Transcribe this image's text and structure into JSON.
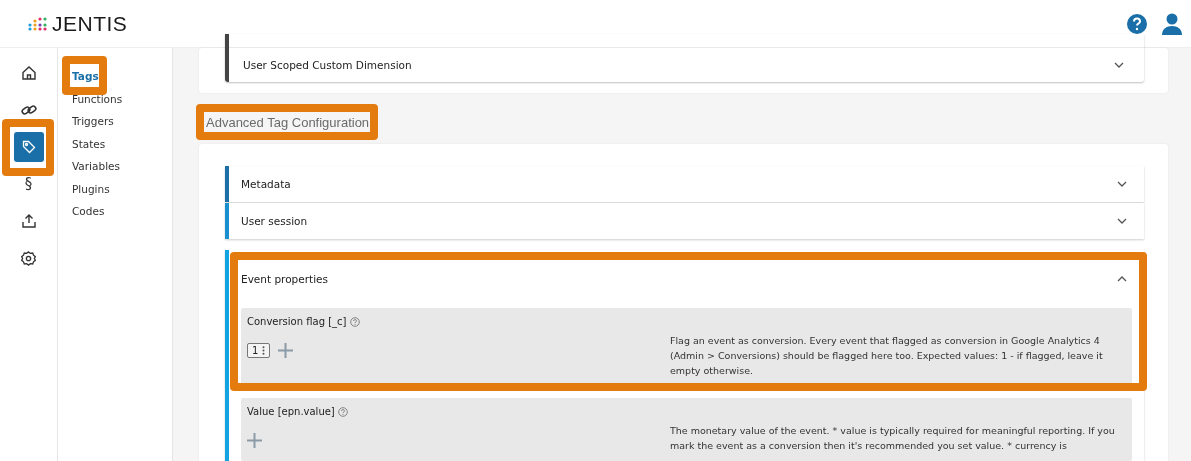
{
  "header": {
    "logo": "JENTIS"
  },
  "nav_rail": [
    {
      "kind": "home",
      "selected": false,
      "highlighted": false
    },
    {
      "kind": "link",
      "selected": false,
      "highlighted": false
    },
    {
      "kind": "tag",
      "selected": true,
      "highlighted": true
    },
    {
      "kind": "text",
      "label": "§",
      "selected": false,
      "highlighted": false
    },
    {
      "kind": "upload",
      "selected": false,
      "highlighted": false
    },
    {
      "kind": "settings",
      "selected": false,
      "highlighted": false
    }
  ],
  "sidebar": {
    "items": [
      {
        "label": "Tags",
        "selected": true,
        "highlighted": true
      },
      {
        "label": "Functions",
        "selected": false,
        "highlighted": false
      },
      {
        "label": "Triggers",
        "selected": false,
        "highlighted": false
      },
      {
        "label": "States",
        "selected": false,
        "highlighted": false
      },
      {
        "label": "Variables",
        "selected": false,
        "highlighted": false
      },
      {
        "label": "Plugins",
        "selected": false,
        "highlighted": false
      },
      {
        "label": "Codes",
        "selected": false,
        "highlighted": false
      }
    ]
  },
  "top_card": {
    "rows": [
      {
        "label": "User Scoped Custom Dimension",
        "expanded": false,
        "color": "#444444"
      }
    ]
  },
  "section": {
    "title": "Advanced Tag Configuration",
    "highlighted": true
  },
  "accordions": [
    {
      "label": "Metadata",
      "expanded": false,
      "highlighted": false,
      "color": "#1a6fa8"
    },
    {
      "label": "User session",
      "expanded": false,
      "highlighted": false,
      "color": "#1a8fd0"
    },
    {
      "label": "Event properties",
      "expanded": true,
      "highlighted": true,
      "color": "#12a3e3",
      "fields": [
        {
          "label": "Conversion flag [_c]",
          "values": [
            "1"
          ],
          "description": "Flag an event as conversion. Every event that flagged as conversion in Google Analytics 4 (Admin > Conversions) should be flagged here too. Expected values: 1 - if flagged, leave it empty otherwise."
        },
        {
          "label": "Value [epn.value]",
          "description": "The monetary value of the event. * value is typically required for meaningful reporting. If you mark the event as a conversion then it's recommended you set value. * currency is"
        }
      ]
    }
  ]
}
